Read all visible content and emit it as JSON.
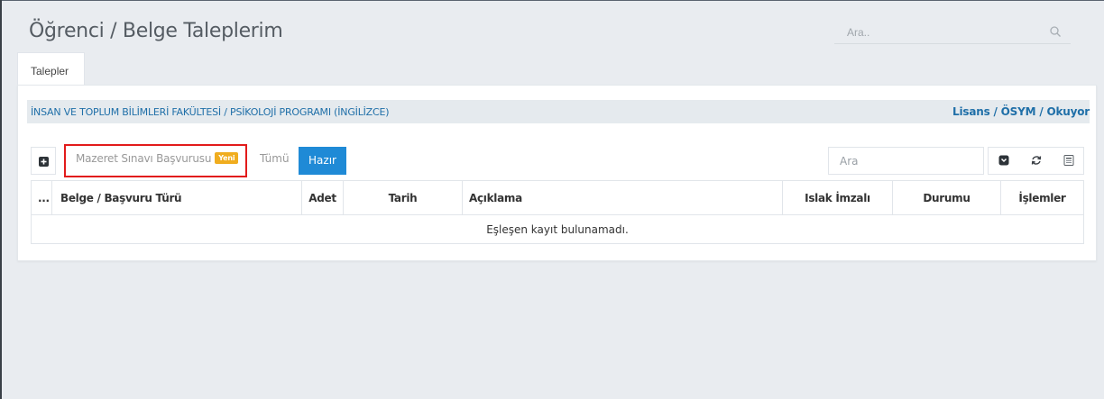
{
  "header": {
    "title": "Öğrenci / Belge Taleplerim",
    "search_placeholder": "Ara.."
  },
  "tabs": [
    {
      "label": "Talepler",
      "active": true
    }
  ],
  "program": {
    "name": "İNSAN VE TOPLUM BİLİMLERİ FAKÜLTESİ / PSİKOLOJİ PROGRAMI (İNGİLİZCE)",
    "status": "Lisans / ÖSYM / Okuyor"
  },
  "toolbar": {
    "application_type": "Mazeret Sınavı Başvurusu",
    "new_badge": "Yeni",
    "filter_all": "Tümü",
    "filter_ready": "Hazır",
    "search_placeholder": "Ara"
  },
  "table": {
    "columns": [
      "...",
      "Belge / Başvuru Türü",
      "Adet",
      "Tarih",
      "Açıklama",
      "Islak İmzalı",
      "Durumu",
      "İşlemler"
    ],
    "empty_message": "Eşleşen kayıt bulunamadı."
  },
  "icons": [
    "search-icon",
    "plus-square-icon",
    "collapse-icon",
    "refresh-icon",
    "export-icon"
  ],
  "colors": {
    "accent": "#1f8ad6",
    "program_text": "#1f6fa8",
    "badge": "#f0ad1f",
    "highlight": "#e21b1b"
  }
}
